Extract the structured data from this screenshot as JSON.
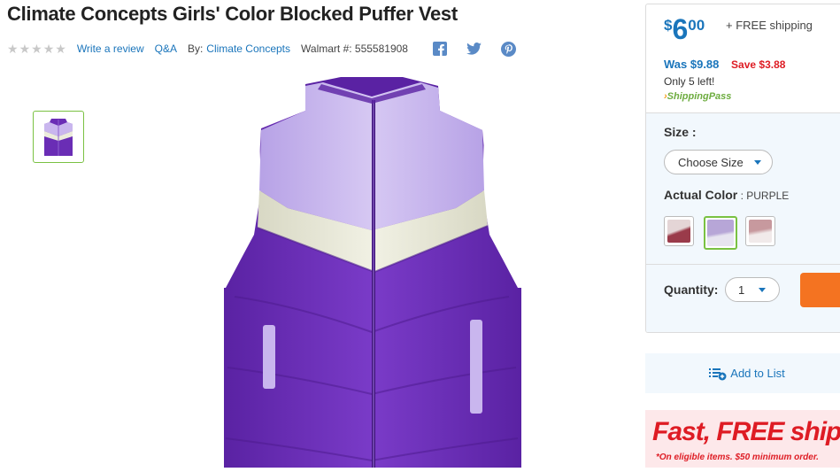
{
  "product": {
    "title": "Climate Concepts Girls' Color Blocked Puffer Vest",
    "rating_stars": 0,
    "write_review": "Write a review",
    "qa": "Q&A",
    "by_label": "By:",
    "brand": "Climate Concepts",
    "walmart_number": "Walmart #: 555581908",
    "colors": {
      "vest_dark": "#6a2db5",
      "vest_light": "#c9b6ee",
      "vest_cream": "#ececdc"
    }
  },
  "social": {
    "icons": [
      "facebook-icon",
      "twitter-icon",
      "pinterest-icon"
    ]
  },
  "pricing": {
    "currency": "$",
    "whole": "6",
    "cents": "00",
    "shipping": "+ FREE shipping",
    "was": "Was $9.88",
    "save": "Save $3.88",
    "stock": "Only 5 left!",
    "shipping_pass": "ShippingPass",
    "price_color": "#1a75bb",
    "save_color": "#de1c24"
  },
  "options": {
    "size_label": "Size",
    "size_suffix": " :",
    "size_select": "Choose Size",
    "color_label": "Actual Color",
    "color_suffix": " : ",
    "color_value": "PURPLE",
    "swatches": [
      {
        "name": "maroon",
        "selected": false,
        "top": "#e4d5d6",
        "bottom": "#9a3b4a"
      },
      {
        "name": "purple",
        "selected": true,
        "top": "#b7a6d7",
        "bottom": "#e7e4f0"
      },
      {
        "name": "pink",
        "selected": false,
        "top": "#c7999e",
        "bottom": "#f1eaea"
      }
    ],
    "quantity_label": "Quantity:",
    "quantity_value": "1"
  },
  "actions": {
    "add_to_list": "Add to List",
    "cart_button_color": "#f47321"
  },
  "promo": {
    "fast": "Fast,",
    "free_shipping": " FREE shippin",
    "subtext": "*On eligible items. $50 minimum order."
  }
}
